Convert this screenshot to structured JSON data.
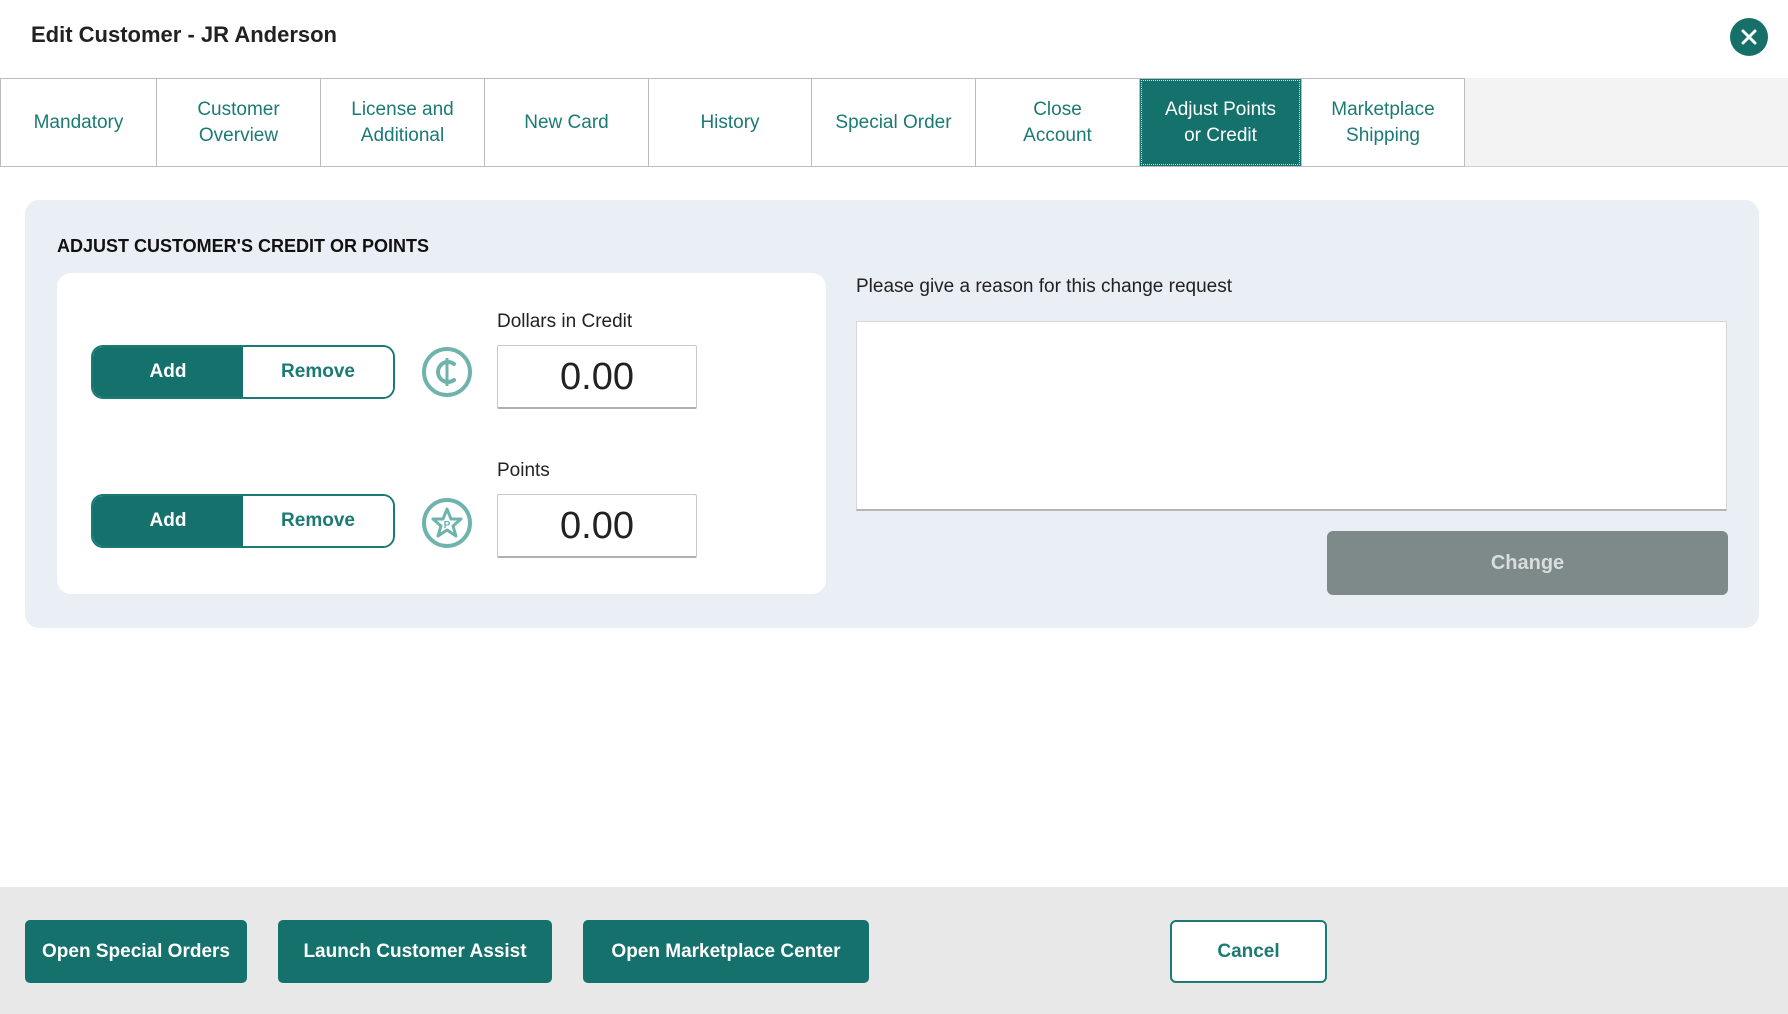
{
  "window": {
    "title": "Edit Customer - JR Anderson",
    "close_icon": "close-icon"
  },
  "tabs": [
    {
      "label": "Mandatory",
      "active": false
    },
    {
      "label": "Customer\nOverview",
      "active": false
    },
    {
      "label": "License and\nAdditional",
      "active": false
    },
    {
      "label": "New Card",
      "active": false
    },
    {
      "label": "History",
      "active": false
    },
    {
      "label": "Special Order",
      "active": false
    },
    {
      "label": "Close\nAccount",
      "active": false
    },
    {
      "label": "Adjust Points\nor Credit",
      "active": true
    },
    {
      "label": "Marketplace\nShipping",
      "active": false
    }
  ],
  "panel": {
    "heading": "ADJUST CUSTOMER'S CREDIT OR POINTS",
    "credit": {
      "add_label": "Add",
      "remove_label": "Remove",
      "selected": "Add",
      "icon": "credit-coin-icon",
      "field_label": "Dollars in Credit",
      "value": "0.00"
    },
    "points": {
      "add_label": "Add",
      "remove_label": "Remove",
      "selected": "Add",
      "icon": "points-star-icon",
      "field_label": "Points",
      "value": "0.00"
    },
    "reason": {
      "label": "Please give a reason for this change request",
      "value": ""
    },
    "change_label": "Change"
  },
  "footer": {
    "open_special_orders": "Open Special Orders",
    "launch_customer_assist": "Launch Customer Assist",
    "open_marketplace_center": "Open Marketplace Center",
    "cancel": "Cancel"
  },
  "colors": {
    "accent": "#14716c",
    "accent_text": "#1b7a74",
    "disabled_button": "#7d8a89",
    "panel_bg": "#eaeef5",
    "footer_bg": "#e8e8e8"
  }
}
